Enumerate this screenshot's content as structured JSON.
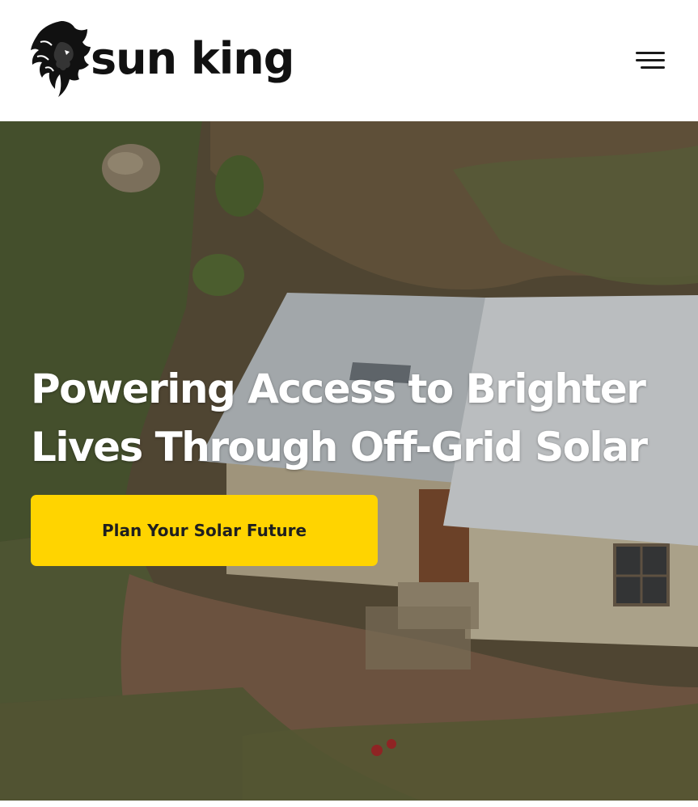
{
  "header": {
    "brand_name": "sun king",
    "logo_icon": "lion-head-icon",
    "menu_icon": "hamburger-menu-icon"
  },
  "hero": {
    "title": "Powering Access to Brighter Lives Through Off-Grid Solar",
    "cta_label": "Plan Your Solar Future"
  },
  "colors": {
    "cta_background": "#ffd400",
    "header_background": "#ffffff",
    "brand_text": "#111111",
    "hero_title": "#ffffff"
  }
}
